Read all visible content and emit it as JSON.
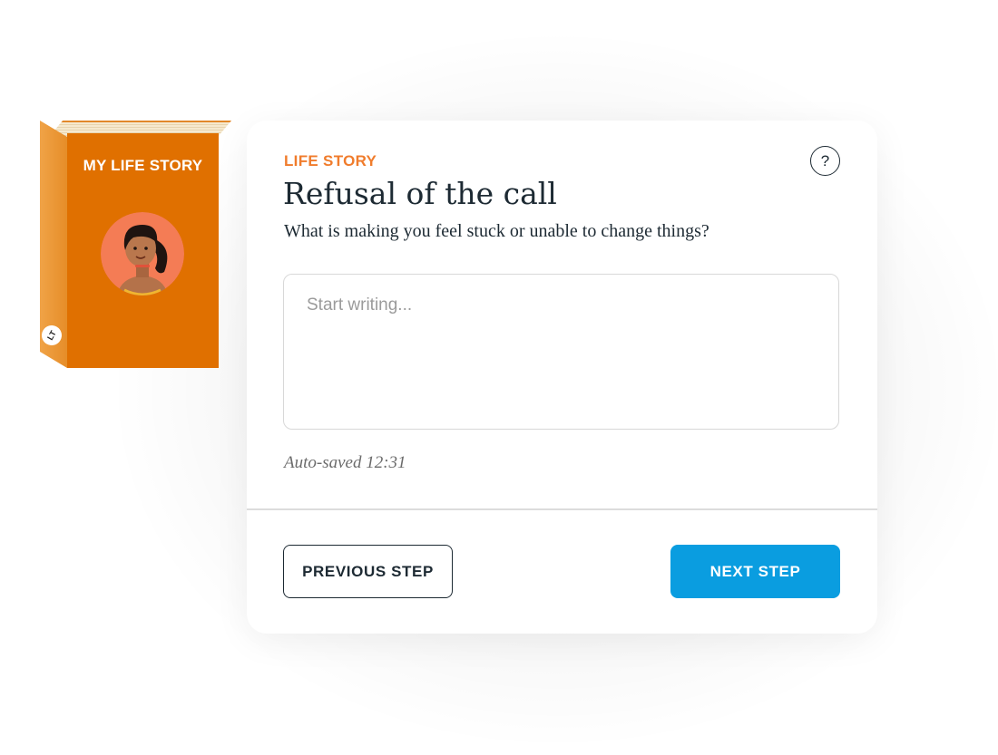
{
  "book": {
    "title": "MY LIFE STORY",
    "logo_text": "LT",
    "cover_color": "#e07000",
    "avatar_icon": "woman-avatar-icon"
  },
  "card": {
    "eyebrow": "LIFE STORY",
    "help_label": "?",
    "title": "Refusal of the call",
    "subtitle": "What is making you feel stuck or unable to change things?",
    "input": {
      "value": "",
      "placeholder": "Start writing..."
    },
    "autosave": "Auto-saved 12:31",
    "buttons": {
      "previous": "PREVIOUS STEP",
      "next": "NEXT STEP"
    }
  },
  "colors": {
    "accent_orange": "#f07c2c",
    "primary_blue": "#0a9de0",
    "text_dark": "#1d2a33"
  }
}
